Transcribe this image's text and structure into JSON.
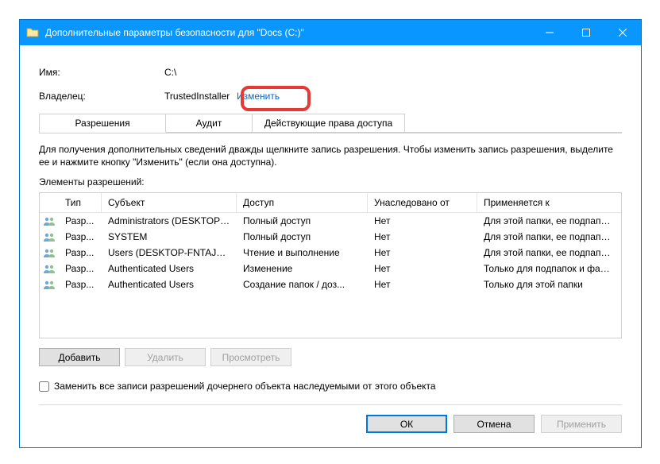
{
  "title": "Дополнительные параметры безопасности  для \"Docs (C:)\"",
  "info": {
    "name_label": "Имя:",
    "name_value": "C:\\",
    "owner_label": "Владелец:",
    "owner_value": "TrustedInstaller",
    "change_link": "Изменить"
  },
  "tabs": {
    "perm": "Разрешения",
    "audit": "Аудит",
    "effective": "Действующие права доступа"
  },
  "help_text": "Для получения дополнительных сведений дважды щелкните запись разрешения. Чтобы изменить запись разрешения, выделите ее и нажмите кнопку \"Изменить\" (если она доступна).",
  "perm_section_label": "Элементы разрешений:",
  "columns": {
    "type": "Тип",
    "subject": "Субъект",
    "access": "Доступ",
    "inherited": "Унаследовано от",
    "applies": "Применяется к"
  },
  "rows": [
    {
      "type": "Разр...",
      "subject": "Administrators (DESKTOP-FN...",
      "access": "Полный доступ",
      "inherited": "Нет",
      "applies": "Для этой папки, ее подпапок ..."
    },
    {
      "type": "Разр...",
      "subject": "SYSTEM",
      "access": "Полный доступ",
      "inherited": "Нет",
      "applies": "Для этой папки, ее подпапок ..."
    },
    {
      "type": "Разр...",
      "subject": "Users (DESKTOP-FNTAJVG\\Us...",
      "access": "Чтение и выполнение",
      "inherited": "Нет",
      "applies": "Для этой папки, ее подпапок ..."
    },
    {
      "type": "Разр...",
      "subject": "Authenticated Users",
      "access": "Изменение",
      "inherited": "Нет",
      "applies": "Только для подпапок и файл..."
    },
    {
      "type": "Разр...",
      "subject": "Authenticated Users",
      "access": "Создание папок / доз...",
      "inherited": "Нет",
      "applies": "Только для этой папки"
    }
  ],
  "buttons": {
    "add": "Добавить",
    "remove": "Удалить",
    "view": "Просмотреть",
    "ok": "ОК",
    "cancel": "Отмена",
    "apply": "Применить"
  },
  "checkbox_label": "Заменить все записи разрешений дочернего объекта наследуемыми от этого объекта"
}
